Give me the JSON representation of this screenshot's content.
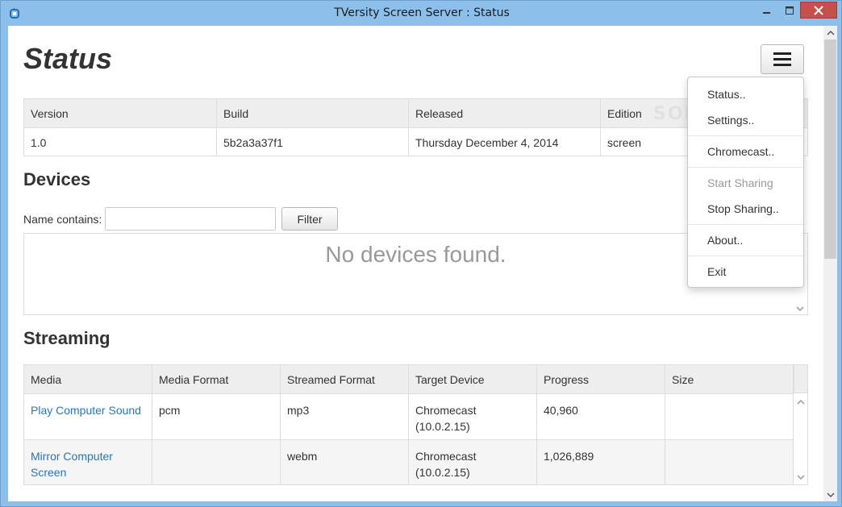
{
  "window": {
    "title": "TVersity Screen Server : Status"
  },
  "page": {
    "title": "Status"
  },
  "version_table": {
    "headers": [
      "Version",
      "Build",
      "Released",
      "Edition"
    ],
    "row": [
      "1.0",
      "5b2a3a37f1",
      "Thursday December 4, 2014",
      "screen"
    ]
  },
  "devices": {
    "heading": "Devices",
    "filter_label": "Name contains:",
    "filter_value": "",
    "filter_button": "Filter",
    "empty_message": "No devices found."
  },
  "streaming": {
    "heading": "Streaming",
    "headers": [
      "Media",
      "Media Format",
      "Streamed Format",
      "Target Device",
      "Progress",
      "Size"
    ],
    "rows": [
      {
        "media_line1": "Play Computer Sound",
        "media_line2": "",
        "media_format": "pcm",
        "streamed_format": "mp3",
        "target_line1": "Chromecast",
        "target_line2": "(10.0.2.15)",
        "progress": "40,960",
        "size": ""
      },
      {
        "media_line1": "Mirror Computer",
        "media_line2": "Screen",
        "media_format": "",
        "streamed_format": "webm",
        "target_line1": "Chromecast",
        "target_line2": "(10.0.2.15)",
        "progress": "1,026,889",
        "size": ""
      }
    ]
  },
  "menu": {
    "items": [
      "Status..",
      "Settings..",
      "Chromecast..",
      "Start Sharing",
      "Stop Sharing..",
      "About..",
      "Exit"
    ]
  },
  "watermark": "SOFTPEDIA",
  "colors": {
    "link": "#2a76b8",
    "titlebar": "#8cc0ea",
    "close_button": "#c7504c",
    "disabled_text": "#999999"
  },
  "icons": {
    "app": "tversity-app-icon",
    "menu": "hamburger-menu-icon",
    "minimize": "minimize-icon",
    "maximize": "maximize-icon",
    "close": "close-icon"
  }
}
